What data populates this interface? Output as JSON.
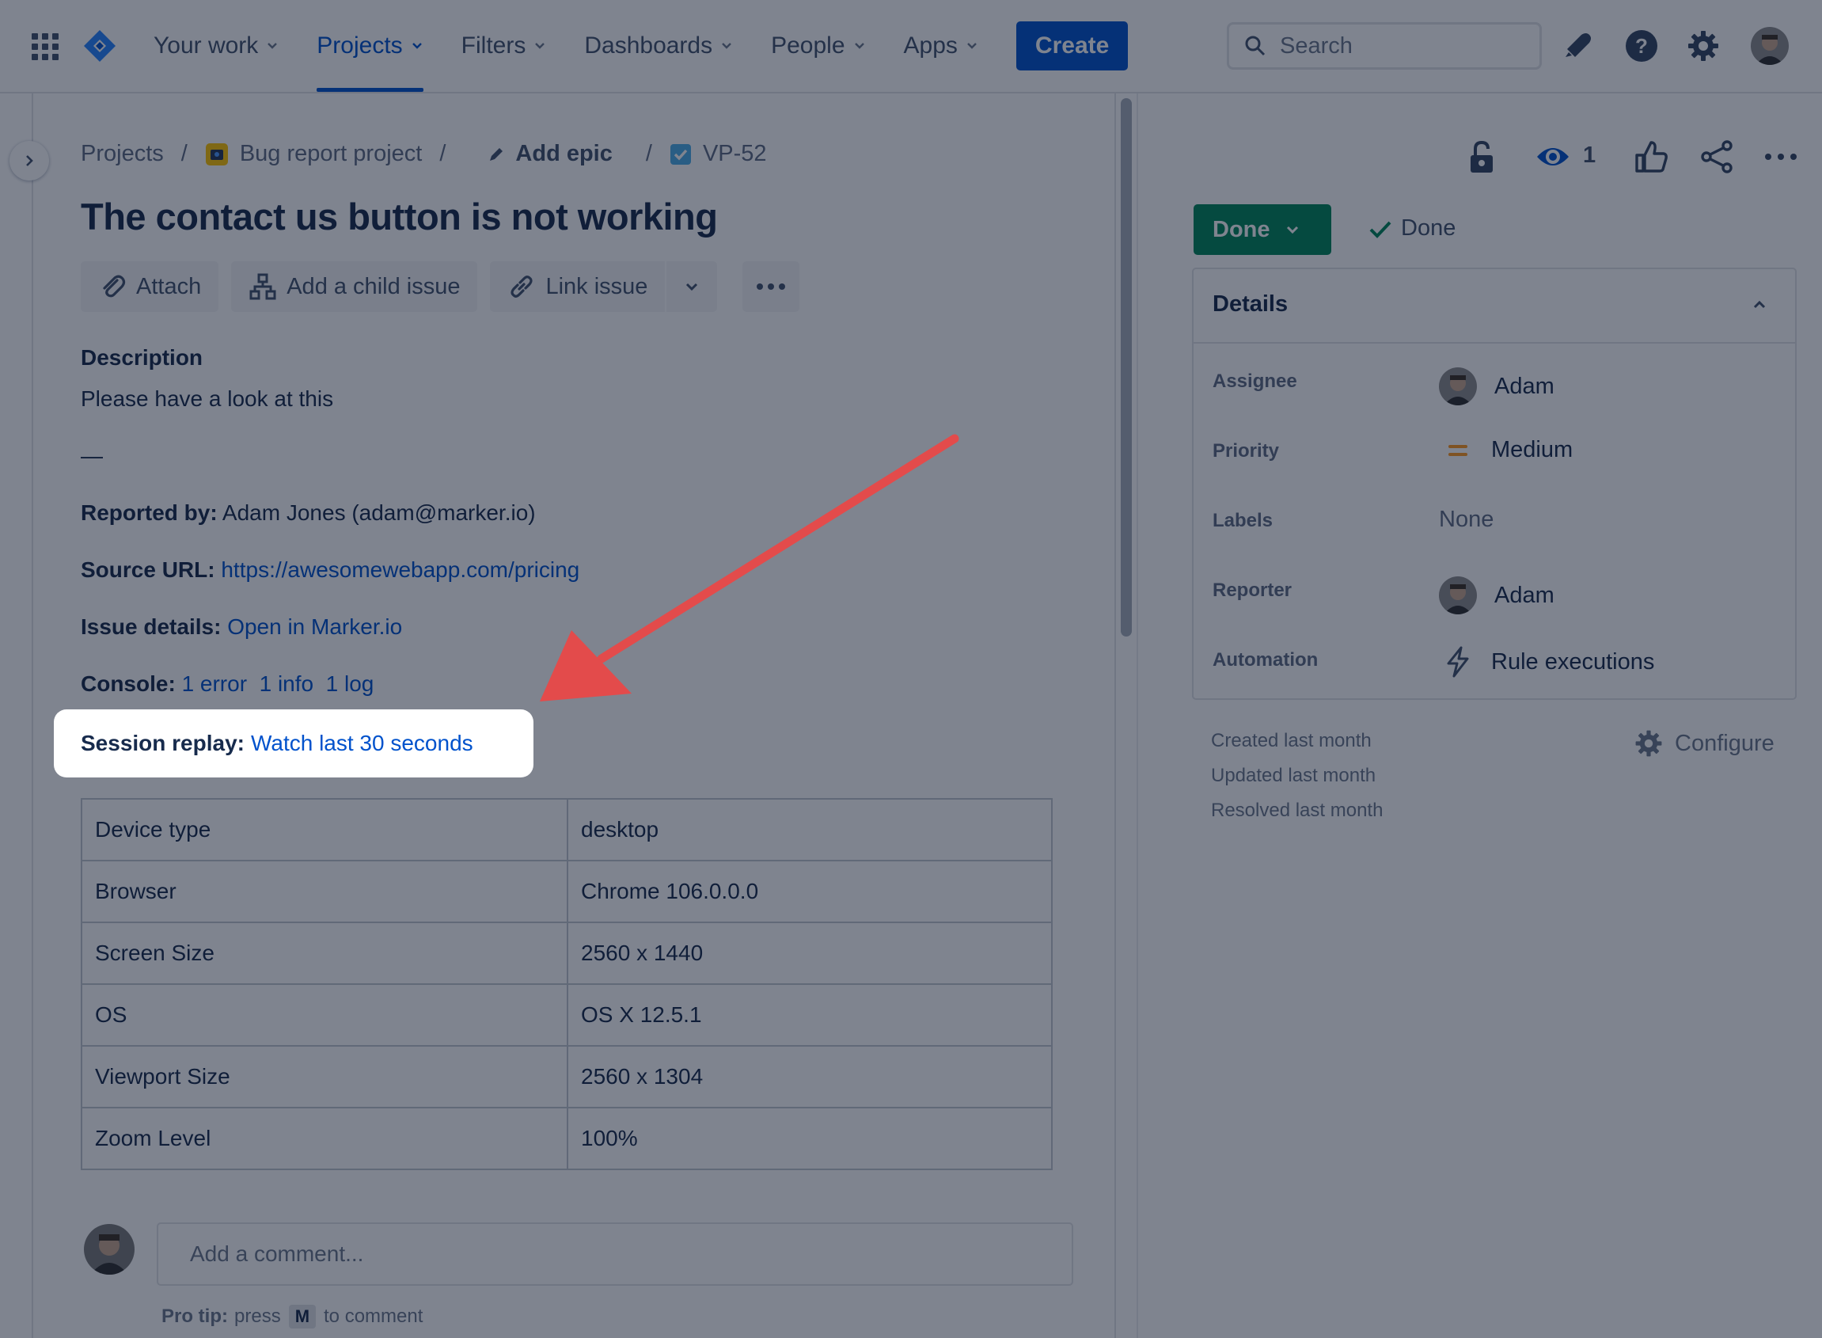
{
  "nav": {
    "items": [
      {
        "label": "Your work",
        "active": false
      },
      {
        "label": "Projects",
        "active": true
      },
      {
        "label": "Filters",
        "active": false
      },
      {
        "label": "Dashboards",
        "active": false
      },
      {
        "label": "People",
        "active": false
      },
      {
        "label": "Apps",
        "active": false
      }
    ],
    "create_label": "Create",
    "search_placeholder": "Search"
  },
  "breadcrumb": {
    "projects": "Projects",
    "project": "Bug report project",
    "epic": "Add epic",
    "issue_key": "VP-52"
  },
  "issue": {
    "title": "The contact us button is not working",
    "actions": {
      "attach": "Attach",
      "child": "Add a child issue",
      "link": "Link issue"
    },
    "description_heading": "Description",
    "description_text": "Please have a look at this",
    "dash": "—",
    "reported_by_label": "Reported by:",
    "reported_by_value": "Adam Jones (adam@marker.io)",
    "source_url_label": "Source URL:",
    "source_url_value": "https://awesomewebapp.com/pricing",
    "issue_details_label": "Issue details:",
    "issue_details_value": "Open in Marker.io",
    "console_label": "Console:",
    "console_error": "1 error",
    "console_info": "1 info",
    "console_log": "1 log",
    "session_label": "Session replay:",
    "session_value": "Watch last 30 seconds",
    "env_table": [
      {
        "key": "Device type",
        "value": "desktop"
      },
      {
        "key": "Browser",
        "value": "Chrome 106.0.0.0"
      },
      {
        "key": "Screen Size",
        "value": "2560 x 1440"
      },
      {
        "key": "OS",
        "value": "OS X 12.5.1"
      },
      {
        "key": "Viewport Size",
        "value": "2560 x 1304"
      },
      {
        "key": "Zoom Level",
        "value": "100%"
      }
    ]
  },
  "comment": {
    "placeholder": "Add a comment...",
    "protip_bold": "Pro tip:",
    "protip_press": "press",
    "protip_key": "M",
    "protip_rest": "to comment"
  },
  "sidebar": {
    "watch_count": "1",
    "status": "Done",
    "resolution": "Done",
    "details_title": "Details",
    "fields": [
      {
        "label": "Assignee",
        "value": "Adam"
      },
      {
        "label": "Priority",
        "value": "Medium"
      },
      {
        "label": "Labels",
        "value": "None"
      },
      {
        "label": "Reporter",
        "value": "Adam"
      },
      {
        "label": "Automation",
        "value": "Rule executions"
      }
    ],
    "created": "Created last month",
    "updated": "Updated last month",
    "resolved": "Resolved last month",
    "configure": "Configure"
  },
  "colors": {
    "brand": "#0052CC",
    "done_green": "#00875A",
    "priority_medium": "#FF991F",
    "annotation_arrow": "#E34B4B"
  },
  "icons": [
    "app-switcher-icon",
    "jira-logo-icon",
    "search-icon",
    "notifications-icon",
    "help-icon",
    "settings-icon",
    "lock-icon",
    "watch-icon",
    "like-icon",
    "share-icon",
    "more-icon",
    "attach-icon",
    "child-issue-icon",
    "link-icon",
    "edit-icon",
    "checkbox-icon",
    "check-icon",
    "lightning-icon",
    "gear-icon"
  ]
}
